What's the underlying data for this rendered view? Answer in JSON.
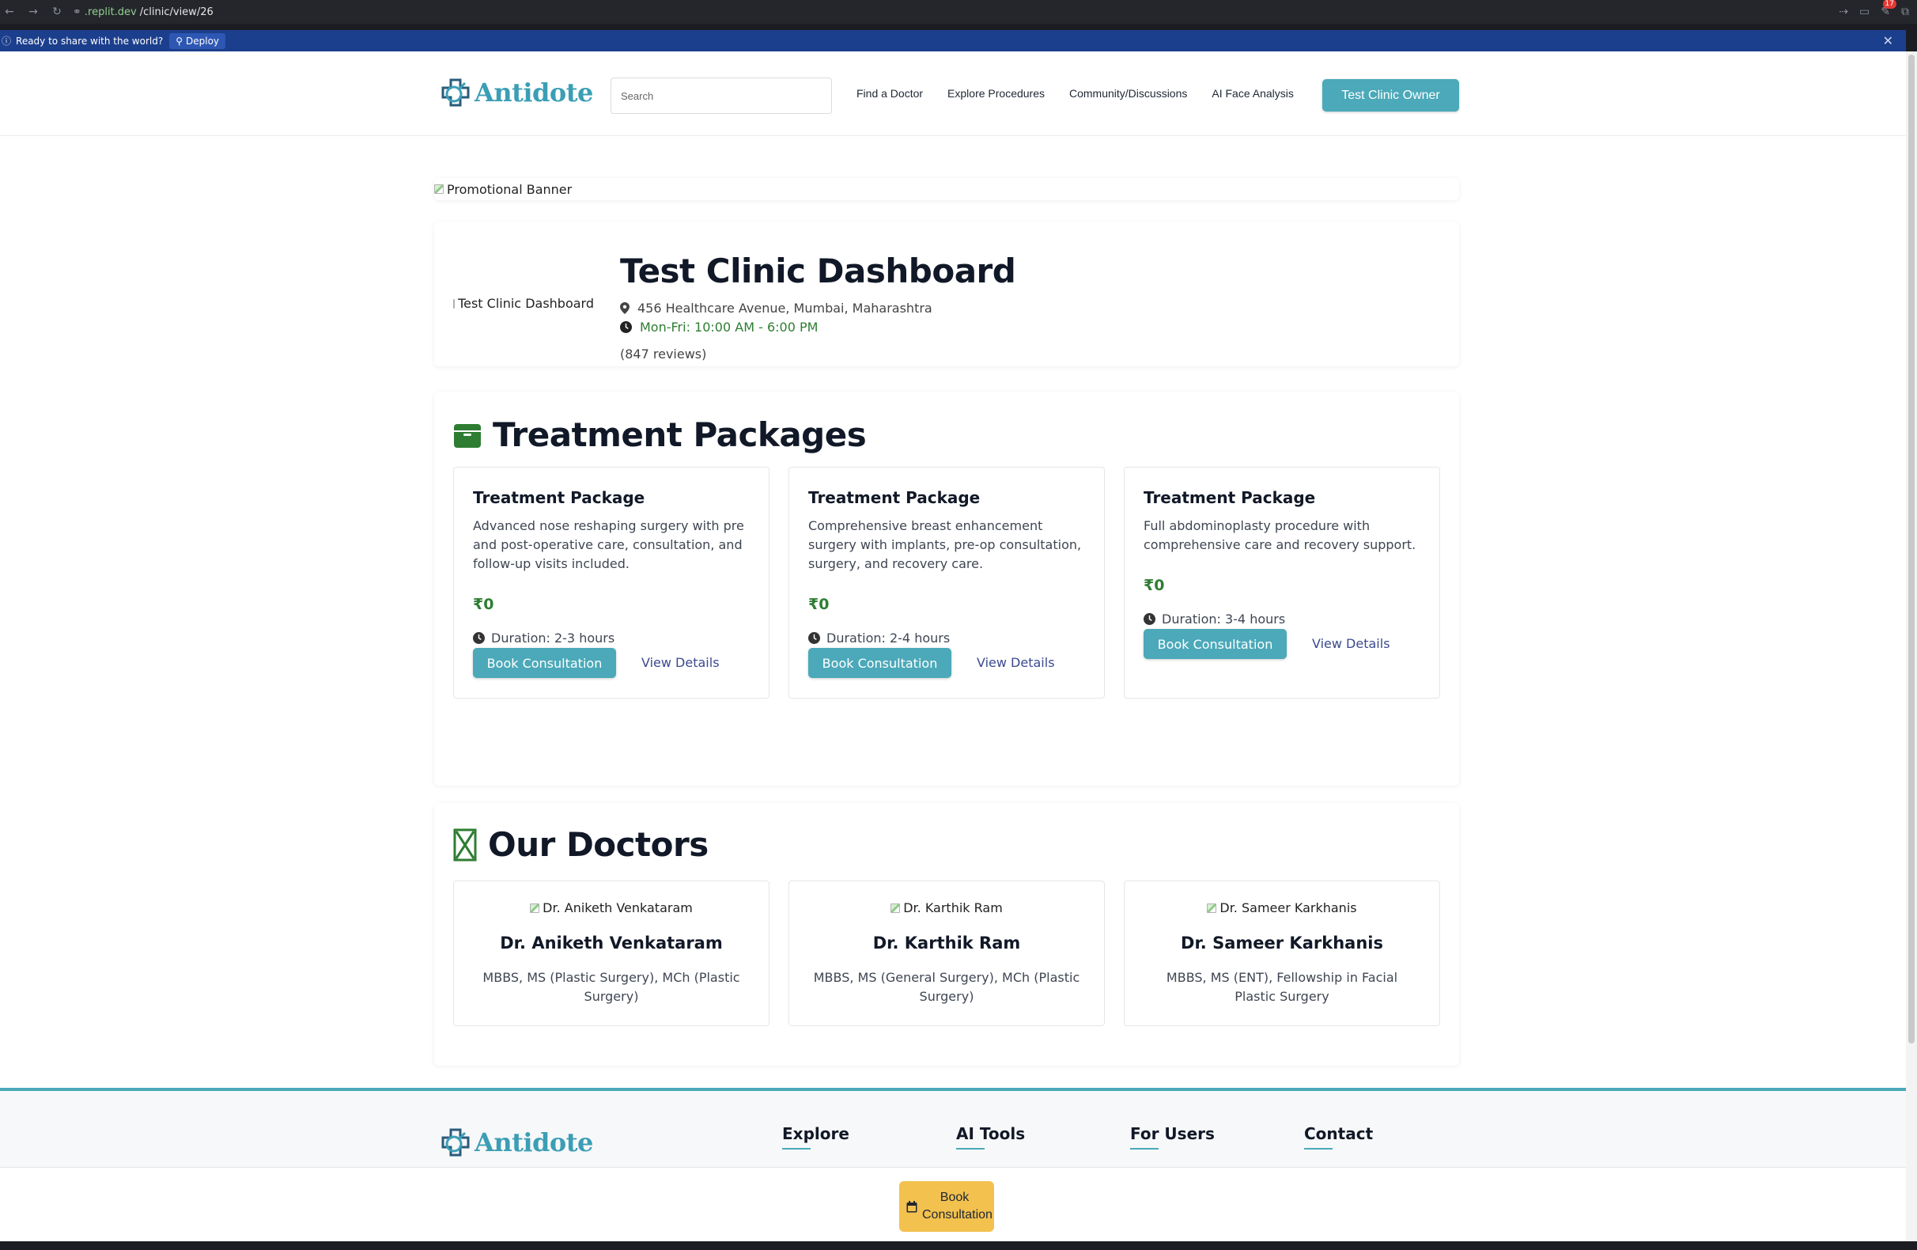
{
  "browser": {
    "url_host": ".replit.dev",
    "url_path": "/clinic/view/26",
    "extension_count": "17"
  },
  "deploy_bar": {
    "message": "Ready to share with the world?",
    "deploy_label": "Deploy"
  },
  "header": {
    "brand": "Antidote",
    "search_placeholder": "Search",
    "nav": [
      "Find a Doctor",
      "Explore Procedures",
      "Community/Discussions",
      "AI Face Analysis"
    ],
    "owner_button": "Test Clinic Owner"
  },
  "banner": {
    "alt": "Promotional Banner"
  },
  "clinic": {
    "logo_alt": "Test Clinic Dashboard",
    "name": "Test Clinic Dashboard",
    "address": "456 Healthcare Avenue, Mumbai, Maharashtra",
    "hours": "Mon-Fri: 10:00 AM - 6:00 PM",
    "reviews": "(847 reviews)"
  },
  "packages": {
    "title": "Treatment Packages",
    "items": [
      {
        "title": "Treatment Package",
        "description": "Advanced nose reshaping surgery with pre and post-operative care, consultation, and follow-up visits included.",
        "price": "₹0",
        "duration": "Duration: 2-3 hours",
        "book": "Book Consultation",
        "details": "View Details"
      },
      {
        "title": "Treatment Package",
        "description": "Comprehensive breast enhancement surgery with implants, pre-op consultation, surgery, and recovery care.",
        "price": "₹0",
        "duration": "Duration: 2-4 hours",
        "book": "Book Consultation",
        "details": "View Details"
      },
      {
        "title": "Treatment Package",
        "description": "Full abdominoplasty procedure with comprehensive care and recovery support.",
        "price": "₹0",
        "duration": "Duration: 3-4 hours",
        "book": "Book Consultation",
        "details": "View Details"
      }
    ]
  },
  "doctors": {
    "title": "Our Doctors",
    "items": [
      {
        "img_alt": "Dr. Aniketh Venkataram",
        "name": "Dr. Aniketh Venkataram",
        "qualifications": "MBBS, MS (Plastic Surgery), MCh (Plastic Surgery)"
      },
      {
        "img_alt": "Dr. Karthik Ram",
        "name": "Dr. Karthik Ram",
        "qualifications": "MBBS, MS (General Surgery), MCh (Plastic Surgery)"
      },
      {
        "img_alt": "Dr. Sameer Karkhanis",
        "name": "Dr. Sameer Karkhanis",
        "qualifications": "MBBS, MS (ENT), Fellowship in Facial Plastic Surgery"
      }
    ]
  },
  "footer": {
    "brand": "Antidote",
    "columns": [
      "Explore",
      "AI Tools",
      "For Users",
      "Contact"
    ]
  },
  "sticky": {
    "book_label": "Book Consultation"
  },
  "colors": {
    "accent": "#4ba9b9",
    "price_green": "#2e7d32",
    "deploy_blue": "#1c3f8d",
    "sticky_yellow": "#f2c14e"
  }
}
